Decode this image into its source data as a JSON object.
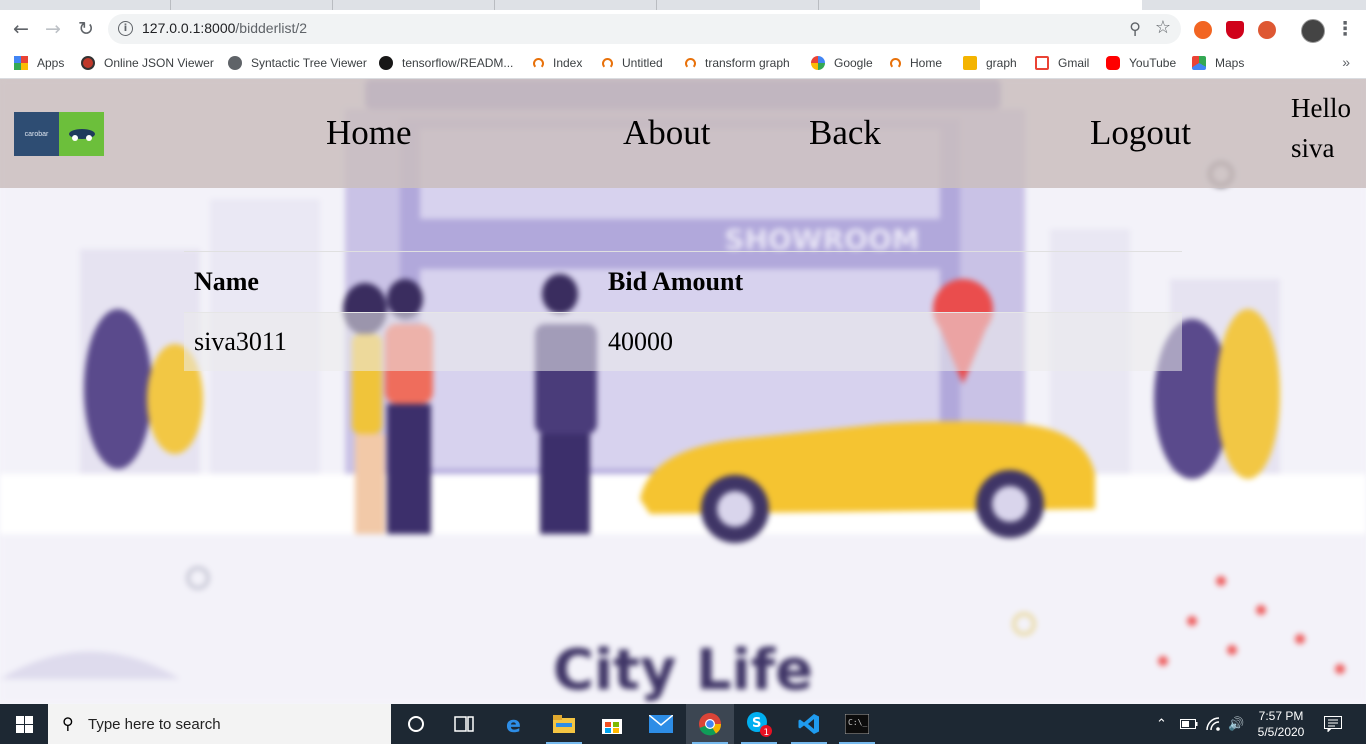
{
  "browser": {
    "url_host": "127.0.0.1:8000",
    "url_path": "/bidderlist/2",
    "bookmarks": [
      {
        "label": "Apps",
        "icon": "apps-grid-icon"
      },
      {
        "label": "Online JSON Viewer",
        "icon": "json-viewer-icon"
      },
      {
        "label": "Syntactic Tree Viewer",
        "icon": "globe-icon"
      },
      {
        "label": "tensorflow/READM...",
        "icon": "github-icon"
      },
      {
        "label": "Index",
        "icon": "jupyter-icon"
      },
      {
        "label": "Untitled",
        "icon": "jupyter-icon"
      },
      {
        "label": "transform graph",
        "icon": "jupyter-icon"
      },
      {
        "label": "Google",
        "icon": "google-icon"
      },
      {
        "label": "Home",
        "icon": "jupyter-icon"
      },
      {
        "label": "graph",
        "icon": "notebook-icon"
      },
      {
        "label": "Gmail",
        "icon": "gmail-icon"
      },
      {
        "label": "YouTube",
        "icon": "youtube-icon"
      },
      {
        "label": "Maps",
        "icon": "maps-icon"
      }
    ]
  },
  "site": {
    "logo_text": "carobar",
    "nav": {
      "home": "Home",
      "about": "About",
      "back": "Back",
      "logout": "Logout",
      "greeting": "Hello siva"
    },
    "table": {
      "headers": [
        "Name",
        "Bid Amount"
      ],
      "rows": [
        {
          "name": "siva3011",
          "bid": "40000"
        }
      ]
    },
    "background_text": {
      "showroom": "SHOWROOM",
      "city": "City Life"
    }
  },
  "taskbar": {
    "search_placeholder": "Type here to search",
    "time": "7:57 PM",
    "date": "5/5/2020",
    "skype_badge": "1"
  },
  "colors": {
    "nav_bar": "#cabebe",
    "car_yellow": "#f5c431",
    "showroom_purple": "#8b80c9",
    "taskbar": "#1d2833"
  }
}
